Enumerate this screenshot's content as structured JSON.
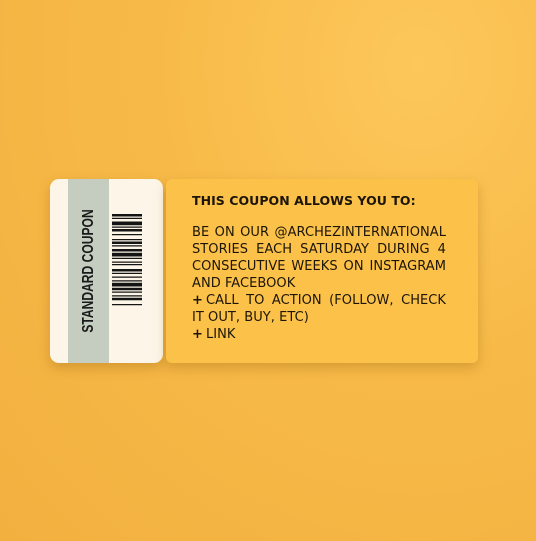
{
  "coupon": {
    "stub_label": "STANDARD COUPON",
    "heading": "THIS COUPON ALLOWS YOU TO:",
    "description": "BE ON OUR @ARCHEZINTERNATIONAL STORIES EACH SATURDAY DURING 4 CONSECUTIVE WEEKS ON INSTAGRAM AND FACEBOOK",
    "items": [
      {
        "bullet": "+",
        "text": "CALL TO ACTION (FOLLOW, CHECK IT OUT, BUY, ETC)"
      },
      {
        "bullet": "+",
        "text": "LINK"
      }
    ]
  },
  "colors": {
    "background": "#f7ba48",
    "panel": "#fbc149",
    "stub": "#fdf6e8",
    "stub_band": "#c4cdbf",
    "text": "#1c1508"
  },
  "icons": [
    "barcode-icon"
  ]
}
